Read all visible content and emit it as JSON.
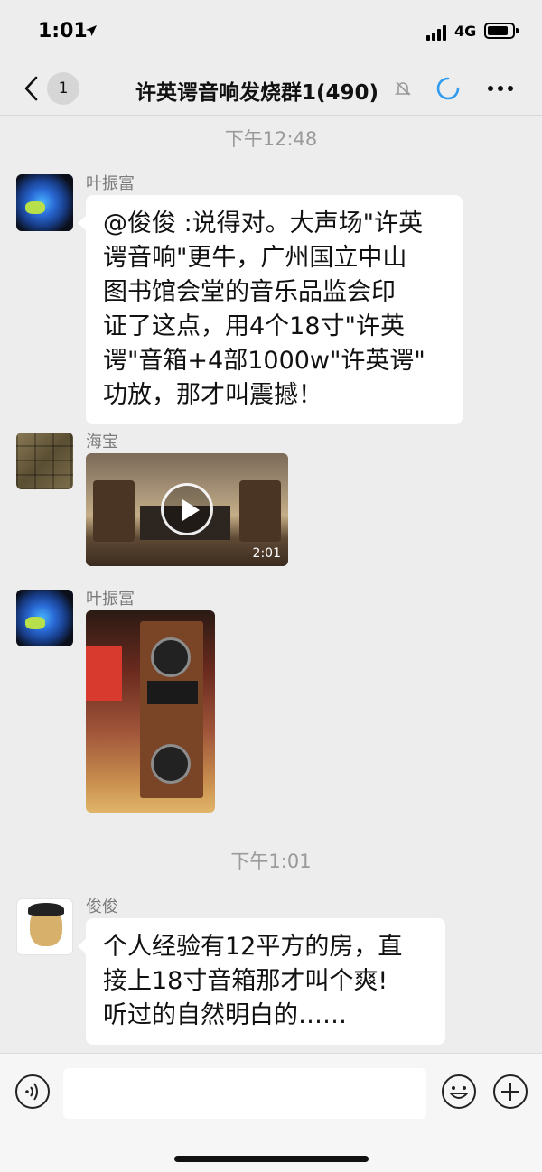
{
  "status_bar": {
    "time": "1:01",
    "network": "4G"
  },
  "nav": {
    "unread_count": "1",
    "title": "许英谔音响发烧群1(490)"
  },
  "messages": [
    {
      "type": "time",
      "text": "下午12:48"
    },
    {
      "type": "text",
      "sender": "叶振富",
      "lines": [
        "@俊俊 :说得对。大声场\"许英",
        "谔音响\"更牛，广州国立中山",
        "图书馆会堂的音乐品监会印",
        "证了这点，用4个18寸\"许英",
        "谔\"音箱+4部1000w\"许英谔\"",
        "功放，那才叫震撼！"
      ]
    },
    {
      "type": "video",
      "sender": "海宝",
      "duration": "2:01"
    },
    {
      "type": "image",
      "sender": "叶振富"
    },
    {
      "type": "time",
      "text": "下午1:01"
    },
    {
      "type": "text",
      "sender": "俊俊",
      "lines": [
        "个人经验有12平方的房，直",
        "接上18寸音箱那才叫个爽!",
        "听过的自然明白的……"
      ]
    }
  ],
  "input": {
    "placeholder": ""
  }
}
